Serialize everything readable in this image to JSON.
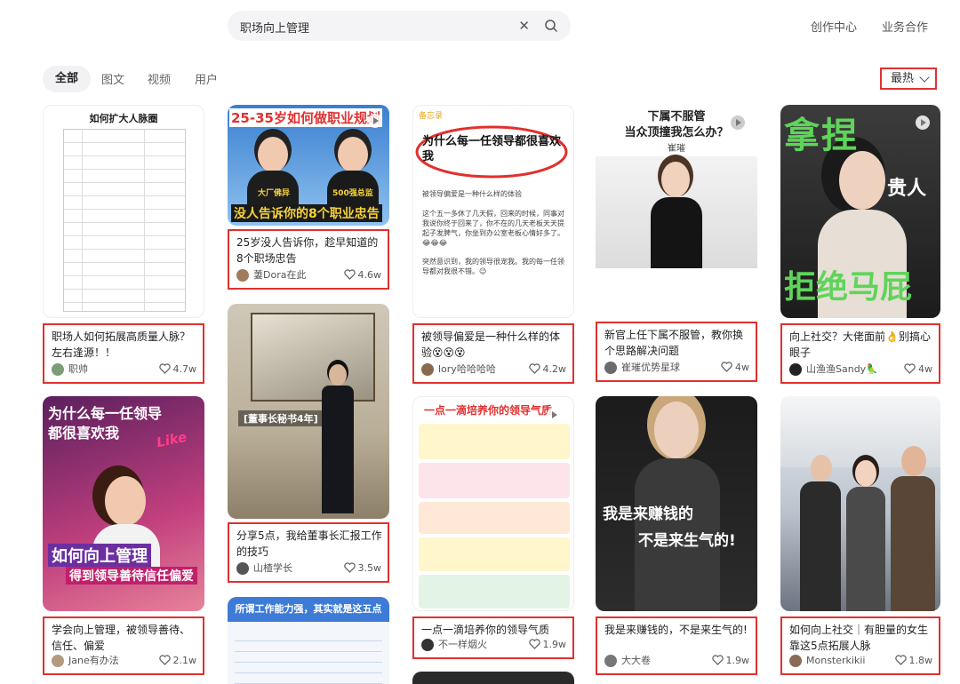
{
  "search": {
    "query": "职场向上管理"
  },
  "header": {
    "creator_center": "创作中心",
    "business": "业务合作"
  },
  "tabs": [
    {
      "label": "全部"
    },
    {
      "label": "图文"
    },
    {
      "label": "视频"
    },
    {
      "label": "用户"
    }
  ],
  "sort": {
    "label": "最热"
  },
  "cards": [
    {
      "title": "职场人如何拓展高质量人脉？左右逢源！！",
      "author": "职帅",
      "likes": "4.7w",
      "cover_text": [
        "如何扩大人脉圈"
      ]
    },
    {
      "title": "学会向上管理，被领导善待、信任、偏爱",
      "author": "Jane有办法",
      "likes": "2.1w",
      "cover_text": [
        "为什么每一任领导",
        "都很喜欢我",
        "Like",
        "如何向上管理",
        "得到领导善待信任偏爱"
      ]
    },
    {
      "title": "25岁没人告诉你，趁早知道的8个职场忠告",
      "author": "萋Dora在此",
      "likes": "4.6w",
      "cover_text": [
        "25-35岁如何做职业规划",
        "大厂佛异",
        "500强总监",
        "没人告诉你的8个职业忠告"
      ]
    },
    {
      "title": "分享5点，我给董事长汇报工作的技巧",
      "author": "山楂学长",
      "likes": "3.5w",
      "cover_text": [
        "[董事长秘书4年]"
      ]
    },
    {
      "title": "",
      "author": "",
      "likes": "",
      "cover_text": [
        "所谓工作能力强，其实就是这五点"
      ]
    },
    {
      "title": "被领导偏爱是一种什么样的体验😵😵😵",
      "author": "lory哈哈哈哈",
      "likes": "4.2w",
      "cover_text": [
        "为什么每一任领导都很喜欢我",
        "被领导偏爱是一种什么样的体验",
        "这个五一多休了几天假，回来的时候，同事对我说你终于回来了，你不在的几天老板天天提起子发脾气，你坐到办公室老板心情好多了。😂😂😂",
        "突然意识到，我的领导很宠我。我的每一任领导都对我很不错。😉",
        "备忘录"
      ]
    },
    {
      "title": "一点一滴培养你的领导气质",
      "author": "不一样烟火",
      "likes": "1.9w",
      "cover_text": [
        "一点一滴培养你的领导气质"
      ]
    },
    {
      "title": "新官上任下属不服管，教你换个思路解决问题",
      "author": "崔璀优势星球",
      "likes": "4w",
      "cover_text": [
        "下属不服管",
        "当众顶撞我怎么办？",
        "崔璀"
      ]
    },
    {
      "title": "我是来赚钱的，不是来生气的!",
      "author": "大大卷",
      "likes": "1.9w",
      "cover_text": [
        "我是来赚钱的",
        "不是来生气的!"
      ]
    },
    {
      "title": "向上社交？大佬面前👌别搞心眼子",
      "author": "山渔渔Sandy🦜",
      "likes": "4w",
      "cover_text": [
        "拿捏",
        "贵人",
        "拒绝马屁"
      ]
    },
    {
      "title": "如何向上社交｜有胆量的女生靠这5点拓展人脉",
      "author": "Monsterkikii",
      "likes": "1.8w",
      "cover_text": []
    }
  ],
  "colors": {
    "highlight": "#e0312f",
    "accent_green": "#5fd45a",
    "accent_yellow": "#f5d33a"
  }
}
